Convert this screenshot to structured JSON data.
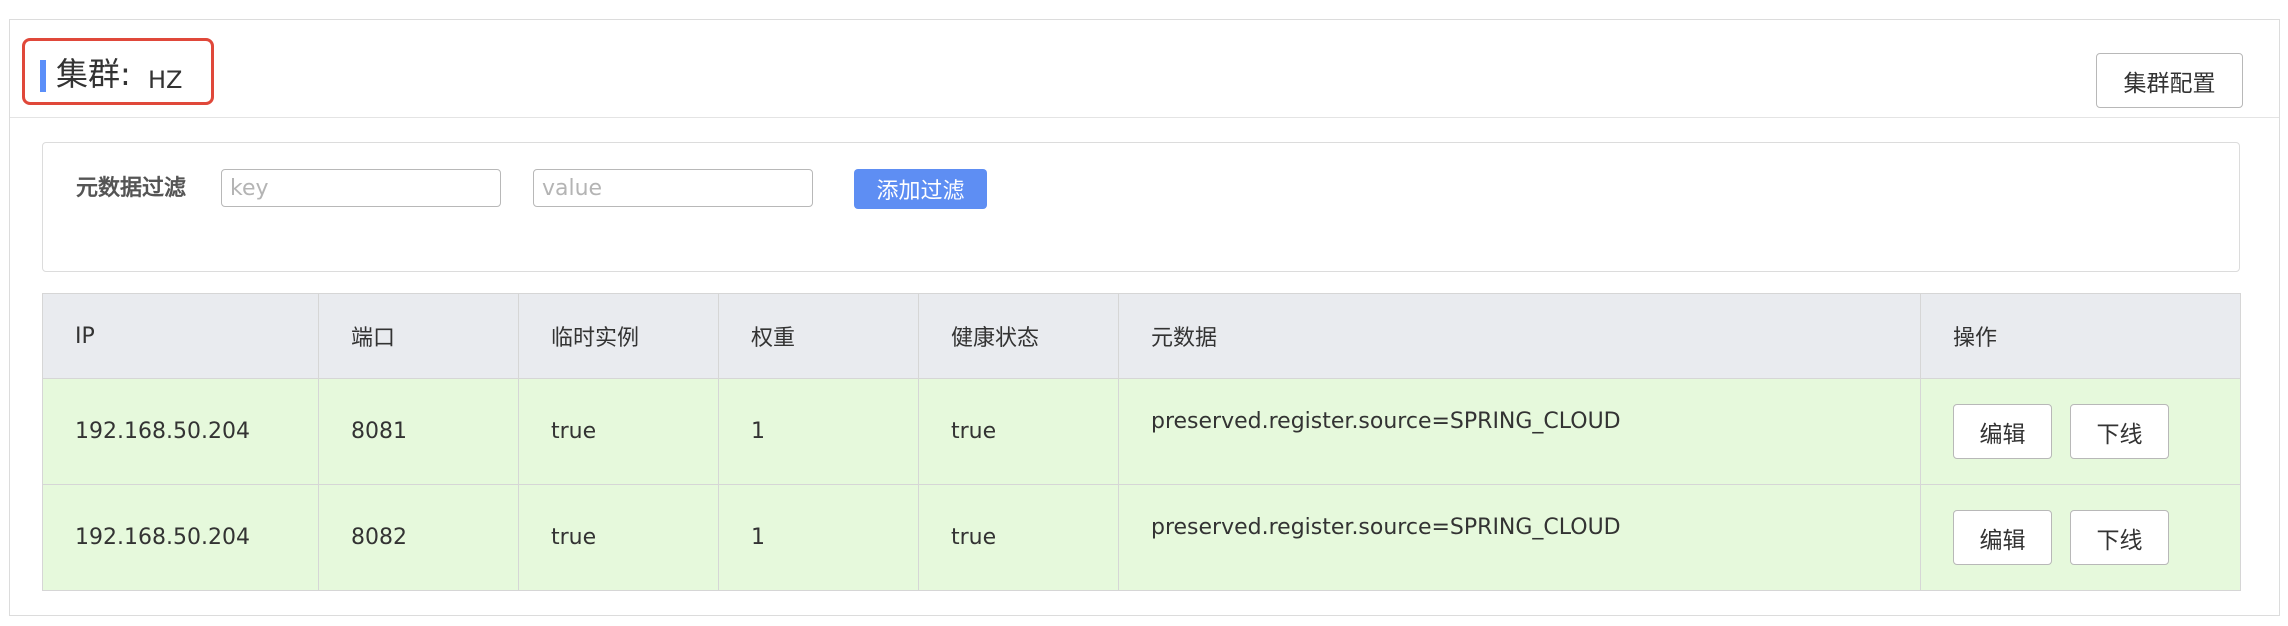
{
  "cluster": {
    "label": "集群",
    "colon": ":",
    "name": "HZ",
    "config_button": "集群配置"
  },
  "filter": {
    "label": "元数据过滤",
    "key_placeholder": "key",
    "value_placeholder": "value",
    "add_button": "添加过滤"
  },
  "table": {
    "headers": [
      "IP",
      "端口",
      "临时实例",
      "权重",
      "健康状态",
      "元数据",
      "操作"
    ],
    "rows": [
      {
        "ip": "192.168.50.204",
        "port": "8081",
        "ephemeral": "true",
        "weight": "1",
        "healthy": "true",
        "metadata": "preserved.register.source=SPRING_CLOUD",
        "edit": "编辑",
        "offline": "下线"
      },
      {
        "ip": "192.168.50.204",
        "port": "8082",
        "ephemeral": "true",
        "weight": "1",
        "healthy": "true",
        "metadata": "preserved.register.source=SPRING_CLOUD",
        "edit": "编辑",
        "offline": "下线"
      }
    ]
  },
  "colors": {
    "accent": "#5e8ef3",
    "highlight_box": "#e0483a",
    "row_background": "#e6f9dc",
    "header_background": "#e9ebef"
  }
}
